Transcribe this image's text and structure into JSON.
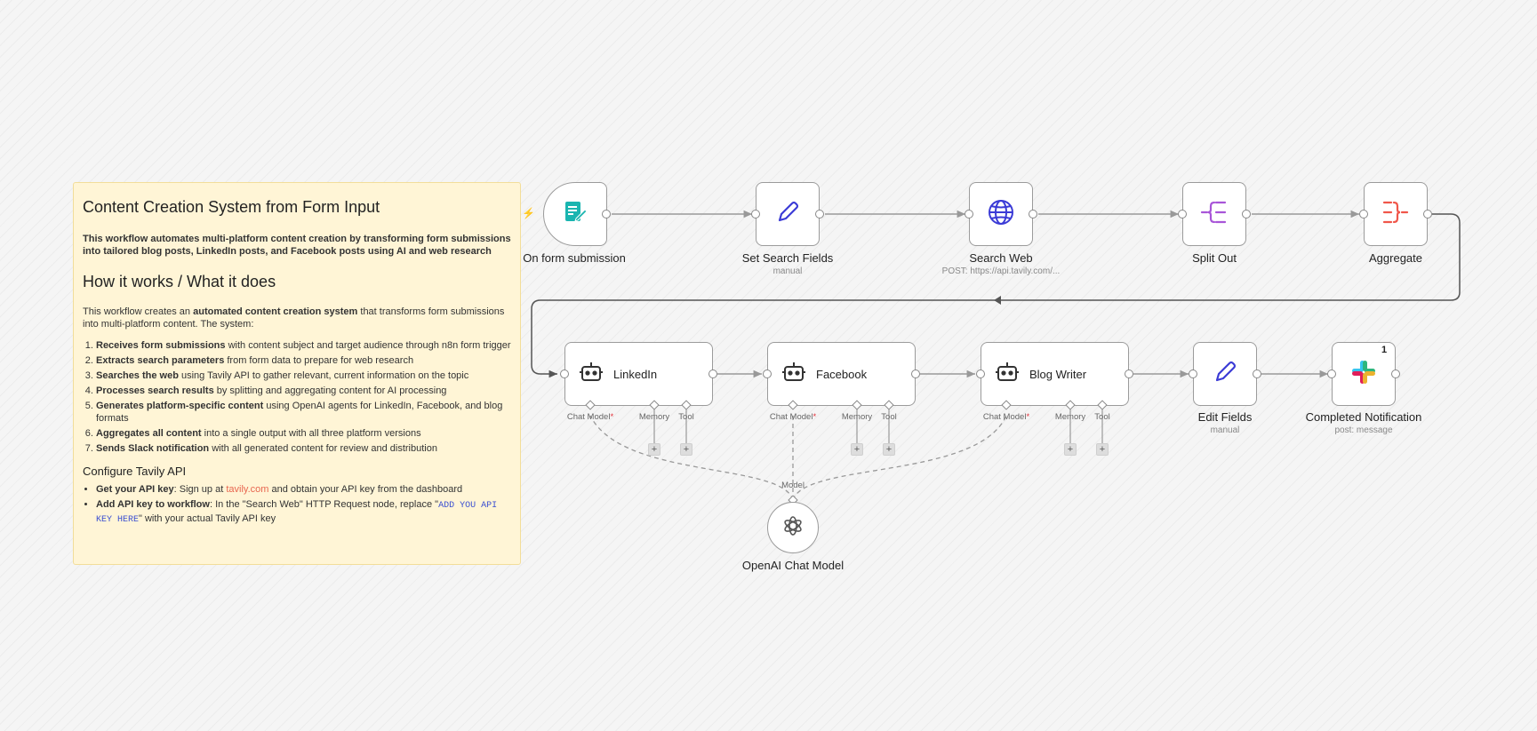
{
  "sticky": {
    "title": "Content Creation System from Form Input",
    "intro": "This workflow automates multi-platform content creation by transforming form submissions into tailored blog posts, LinkedIn posts, and Facebook posts using AI and web research",
    "how_heading": "How it works / What it does",
    "how_intro_pre": "This workflow creates an ",
    "how_intro_bold": "automated content creation system",
    "how_intro_post": " that transforms form submissions into multi-platform content. The system:",
    "steps": [
      {
        "bold": "Receives form submissions",
        "text": " with content subject and target audience through n8n form trigger"
      },
      {
        "bold": "Extracts search parameters",
        "text": " from form data to prepare for web research"
      },
      {
        "bold": "Searches the web",
        "text": " using Tavily API to gather relevant, current information on the topic"
      },
      {
        "bold": "Processes search results",
        "text": " by splitting and aggregating content for AI processing"
      },
      {
        "bold": "Generates platform-specific content",
        "text": " using OpenAI agents for LinkedIn, Facebook, and blog formats"
      },
      {
        "bold": "Aggregates all content",
        "text": " into a single output with all three platform versions"
      },
      {
        "bold": "Sends Slack notification",
        "text": " with all generated content for review and distribution"
      }
    ],
    "config_heading": "Configure Tavily API",
    "config_1_bold": "Get your API key",
    "config_1_pre": ": Sign up at ",
    "config_1_link": "tavily.com",
    "config_1_post": " and obtain your API key from the dashboard",
    "config_2_bold": "Add API key to workflow",
    "config_2_pre": ": In the \"Search Web\" HTTP Request node, replace \"",
    "config_2_code": "ADD YOU API KEY HERE",
    "config_2_post": "\" with your actual Tavily API key"
  },
  "nodes": {
    "form": {
      "title": "On form submission",
      "icon": "form-edit-icon",
      "color": "#1ab5b0"
    },
    "set_search": {
      "title": "Set Search Fields",
      "subtitle": "manual",
      "icon": "pencil-icon",
      "color": "#3b3bd6"
    },
    "search_web": {
      "title": "Search Web",
      "subtitle": "POST: https://api.tavily.com/...",
      "icon": "globe-icon",
      "color": "#3b3bd6"
    },
    "split_out": {
      "title": "Split Out",
      "icon": "split-out-icon",
      "color": "#a855d8"
    },
    "aggregate": {
      "title": "Aggregate",
      "icon": "aggregate-icon",
      "color": "#f0564a"
    },
    "linkedin": {
      "label": "LinkedIn",
      "icon": "robot-icon"
    },
    "facebook": {
      "label": "Facebook",
      "icon": "robot-icon"
    },
    "blog": {
      "label": "Blog Writer",
      "icon": "robot-icon"
    },
    "edit_fields": {
      "title": "Edit Fields",
      "subtitle": "manual",
      "icon": "pencil-icon",
      "color": "#3b3bd6"
    },
    "slack": {
      "title": "Completed Notification",
      "subtitle": "post: message",
      "icon": "slack-icon",
      "badge": "1"
    },
    "openai": {
      "title": "OpenAI Chat Model",
      "port_label": "Model",
      "icon": "openai-icon"
    }
  },
  "sub_labels": {
    "chat_model": "Chat Model",
    "required": "*",
    "memory": "Memory",
    "tool": "Tool",
    "plus": "+"
  }
}
